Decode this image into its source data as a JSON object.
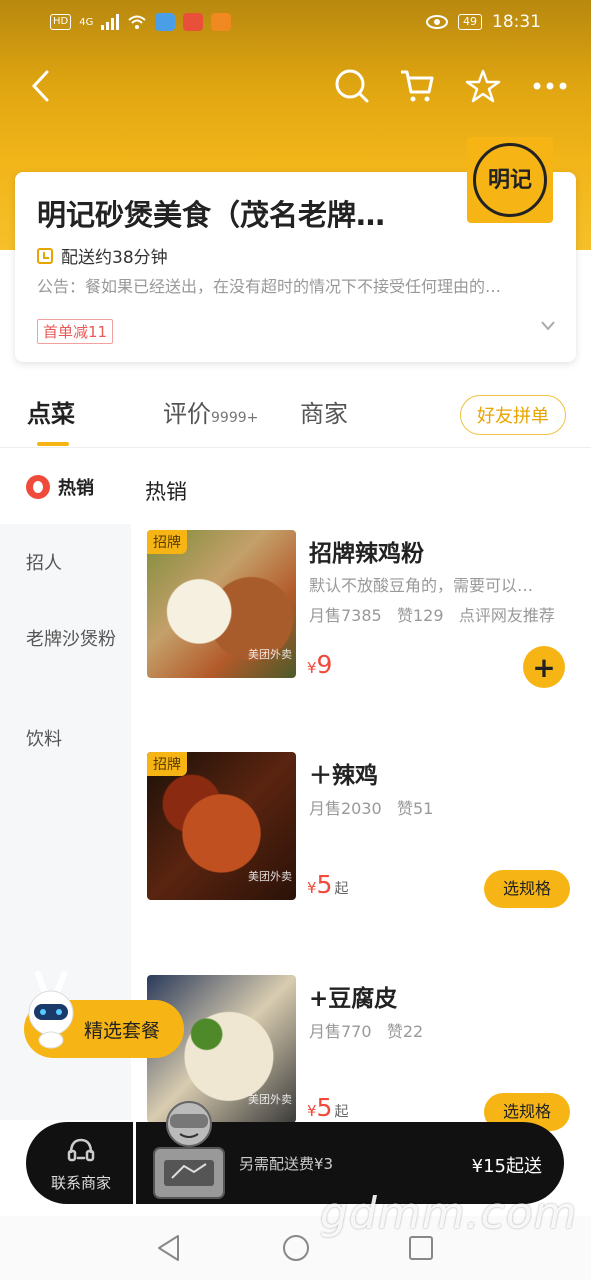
{
  "status_bar": {
    "network": "4G",
    "battery": "49",
    "time": "18:31"
  },
  "store": {
    "name": "明记砂煲美食（茂名老牌…",
    "delivery_time": "配送约38分钟",
    "notice": "公告：餐如果已经送出，在没有超时的情况下不接受任何理由的…",
    "promo": "首单减11",
    "logo_text": "明记"
  },
  "tabs": [
    {
      "label": "点菜",
      "active": true
    },
    {
      "label": "评价",
      "badge": "9999+"
    },
    {
      "label": "商家"
    }
  ],
  "group_order_button": "好友拼单",
  "sidebar": {
    "hot_label": "热销",
    "items": [
      "招人",
      "老牌沙煲粉",
      "饮料"
    ]
  },
  "section_title": "热销",
  "foods": [
    {
      "tag": "招牌",
      "name": "招牌辣鸡粉",
      "desc": "默认不放酸豆角的，需要可以…",
      "sales": "月售7385",
      "likes": "赞129",
      "recommend": "点评网友推荐",
      "currency": "¥",
      "price": "9",
      "action": "+",
      "watermark": "美团外卖"
    },
    {
      "tag": "招牌",
      "name": "＋辣鸡",
      "sales": "月售2030",
      "likes": "赞51",
      "currency": "¥",
      "price": "5",
      "price_suffix": "起",
      "action": "选规格",
      "watermark": "美团外卖"
    },
    {
      "name": "+豆腐皮",
      "sales": "月售770",
      "likes": "赞22",
      "currency": "¥",
      "price": "5",
      "price_suffix": "起",
      "action": "选规格",
      "watermark": "美团外卖"
    }
  ],
  "combo_button": "精选套餐",
  "cart_bar": {
    "contact": "联系商家",
    "delivery_fee": "另需配送费¥3",
    "min_order": "¥15起送"
  },
  "watermark": "gdmm.com",
  "colors": {
    "brand_yellow": "#f6b515",
    "price_red": "#f04a3a"
  }
}
